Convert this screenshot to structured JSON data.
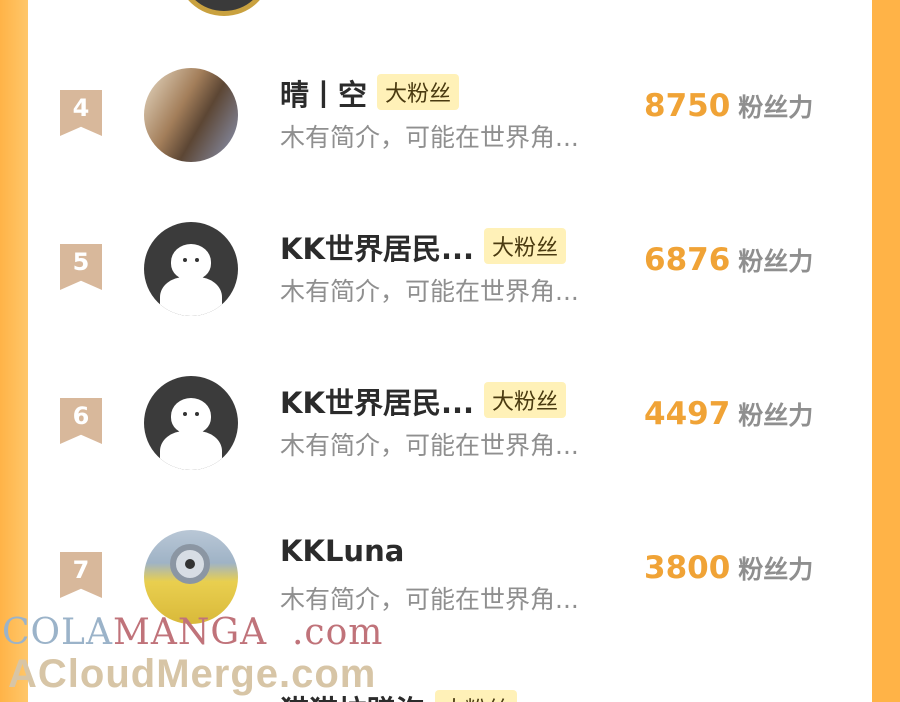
{
  "leaderboard": {
    "rows": [
      {
        "rank": "4",
        "name": "晴丨空",
        "badge": "大粉丝",
        "bio": "木有简介，可能在世界角...",
        "score": "8750",
        "unit": "粉丝力"
      },
      {
        "rank": "5",
        "name": "KK世界居民...",
        "badge": "大粉丝",
        "bio": "木有简介，可能在世界角...",
        "score": "6876",
        "unit": "粉丝力"
      },
      {
        "rank": "6",
        "name": "KK世界居民...",
        "badge": "大粉丝",
        "bio": "木有简介，可能在世界角...",
        "score": "4497",
        "unit": "粉丝力"
      },
      {
        "rank": "7",
        "name": "KKLuna",
        "badge": "",
        "bio": "木有简介，可能在世界角...",
        "score": "3800",
        "unit": "粉丝力"
      }
    ],
    "partial_row": {
      "name": "猫猫拉蹭泡",
      "badge": "大粉丝"
    }
  },
  "watermark": {
    "line1_a": "COLA",
    "line1_b": "MANGA",
    "line1_c": ".com",
    "line2": "ACloudMerge.com"
  },
  "colors": {
    "accent": "#f0a336",
    "frame": "#ffb347",
    "badge_bg": "#fff1b8",
    "rank_bg": "#d8b89b"
  }
}
